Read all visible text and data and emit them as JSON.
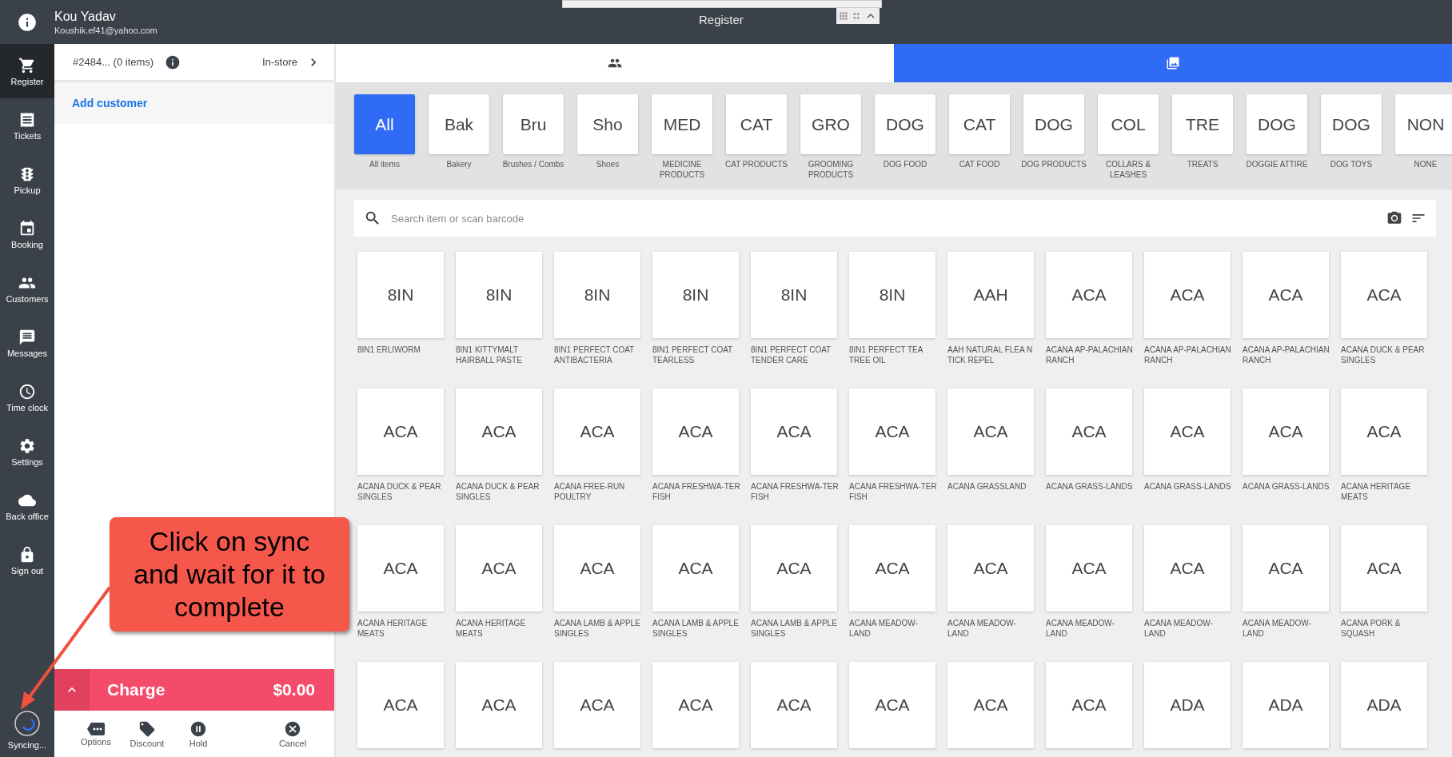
{
  "header": {
    "user_name": "Kou Yadav",
    "user_email": "Koushik.ef41@yahoo.com",
    "title": "Register"
  },
  "sidebar": {
    "items": [
      {
        "label": "Register",
        "selected": true
      },
      {
        "label": "Tickets",
        "selected": false
      },
      {
        "label": "Pickup",
        "selected": false
      },
      {
        "label": "Booking",
        "selected": false
      },
      {
        "label": "Customers",
        "selected": false
      },
      {
        "label": "Messages",
        "selected": false
      },
      {
        "label": "Time clock",
        "selected": false
      },
      {
        "label": "Settings",
        "selected": false
      },
      {
        "label": "Back office",
        "selected": false
      },
      {
        "label": "Sign out",
        "selected": false
      }
    ],
    "sync_label": "Syncing..."
  },
  "ticket": {
    "number": "#2484... (0 items)",
    "order_type": "In-store",
    "add_customer": "Add customer"
  },
  "charge": {
    "label": "Charge",
    "amount": "$0.00"
  },
  "actions": [
    {
      "label": "Options"
    },
    {
      "label": "Discount"
    },
    {
      "label": "Hold"
    },
    {
      "label": "Cancel"
    }
  ],
  "panel_tabs": [
    {
      "selected": false
    },
    {
      "selected": true
    }
  ],
  "categories": [
    {
      "abbr": "All",
      "label": "All items",
      "selected": true
    },
    {
      "abbr": "Bak",
      "label": "Bakery",
      "selected": false
    },
    {
      "abbr": "Bru",
      "label": "Brushes / Combs",
      "selected": false
    },
    {
      "abbr": "Sho",
      "label": "Shoes",
      "selected": false
    },
    {
      "abbr": "MED",
      "label": "MEDICINE PRODUCTS",
      "selected": false
    },
    {
      "abbr": "CAT",
      "label": "CAT PRODUCTS",
      "selected": false
    },
    {
      "abbr": "GRO",
      "label": "GROOMING PRODUCTS",
      "selected": false
    },
    {
      "abbr": "DOG",
      "label": "DOG FOOD",
      "selected": false
    },
    {
      "abbr": "CAT",
      "label": "CAT FOOD",
      "selected": false
    },
    {
      "abbr": "DOG",
      "label": "DOG PRODUCTS",
      "selected": false
    },
    {
      "abbr": "COL",
      "label": "COLLARS & LEASHES",
      "selected": false
    },
    {
      "abbr": "TRE",
      "label": "TREATS",
      "selected": false
    },
    {
      "abbr": "DOG",
      "label": "DOGGIE ATTIRE",
      "selected": false
    },
    {
      "abbr": "DOG",
      "label": "DOG TOYS",
      "selected": false
    },
    {
      "abbr": "NON",
      "label": "NONE",
      "selected": false
    }
  ],
  "search": {
    "placeholder": "Search item or scan barcode"
  },
  "products": [
    {
      "abbr": "8IN",
      "name": "8IN1 ERLIWORM"
    },
    {
      "abbr": "8IN",
      "name": "8IN1 KITTYMALT HAIRBALL PASTE"
    },
    {
      "abbr": "8IN",
      "name": "8IN1 PERFECT COAT ANTIBACTERIA"
    },
    {
      "abbr": "8IN",
      "name": "8IN1 PERFECT COAT TEARLESS"
    },
    {
      "abbr": "8IN",
      "name": "8IN1 PERFECT COAT TENDER CARE"
    },
    {
      "abbr": "8IN",
      "name": "8IN1 PERFECT TEA TREE OIL"
    },
    {
      "abbr": "AAH",
      "name": "AAH NATURAL FLEA N TICK REPEL"
    },
    {
      "abbr": "ACA",
      "name": "ACANA AP-PALACHIAN RANCH"
    },
    {
      "abbr": "ACA",
      "name": "ACANA AP-PALACHIAN RANCH"
    },
    {
      "abbr": "ACA",
      "name": "ACANA AP-PALACHIAN RANCH"
    },
    {
      "abbr": "ACA",
      "name": "ACANA DUCK & PEAR SINGLES"
    },
    {
      "abbr": "ACA",
      "name": "ACANA DUCK & PEAR SINGLES"
    },
    {
      "abbr": "ACA",
      "name": "ACANA DUCK & PEAR SINGLES"
    },
    {
      "abbr": "ACA",
      "name": "ACANA FREE-RUN POULTRY"
    },
    {
      "abbr": "ACA",
      "name": "ACANA FRESHWA-TER FISH"
    },
    {
      "abbr": "ACA",
      "name": "ACANA FRESHWA-TER FISH"
    },
    {
      "abbr": "ACA",
      "name": "ACANA FRESHWA-TER FISH"
    },
    {
      "abbr": "ACA",
      "name": "ACANA GRASSLAND"
    },
    {
      "abbr": "ACA",
      "name": "ACANA GRASS-LANDS"
    },
    {
      "abbr": "ACA",
      "name": "ACANA GRASS-LANDS"
    },
    {
      "abbr": "ACA",
      "name": "ACANA GRASS-LANDS"
    },
    {
      "abbr": "ACA",
      "name": "ACANA HERITAGE MEATS"
    },
    {
      "abbr": "ACA",
      "name": "ACANA HERITAGE MEATS"
    },
    {
      "abbr": "ACA",
      "name": "ACANA HERITAGE MEATS"
    },
    {
      "abbr": "ACA",
      "name": "ACANA LAMB & APPLE SINGLES"
    },
    {
      "abbr": "ACA",
      "name": "ACANA LAMB & APPLE SINGLES"
    },
    {
      "abbr": "ACA",
      "name": "ACANA LAMB & APPLE SINGLES"
    },
    {
      "abbr": "ACA",
      "name": "ACANA MEADOW-LAND"
    },
    {
      "abbr": "ACA",
      "name": "ACANA MEADOW-LAND"
    },
    {
      "abbr": "ACA",
      "name": "ACANA MEADOW-LAND"
    },
    {
      "abbr": "ACA",
      "name": "ACANA MEADOW-LAND"
    },
    {
      "abbr": "ACA",
      "name": "ACANA MEADOW-LAND"
    },
    {
      "abbr": "ACA",
      "name": "ACANA PORK & SQUASH"
    },
    {
      "abbr": "ACA"
    },
    {
      "abbr": "ACA"
    },
    {
      "abbr": "ACA"
    },
    {
      "abbr": "ACA"
    },
    {
      "abbr": "ACA"
    },
    {
      "abbr": "ACA"
    },
    {
      "abbr": "ACA"
    },
    {
      "abbr": "ACA"
    },
    {
      "abbr": "ADA"
    },
    {
      "abbr": "ADA"
    },
    {
      "abbr": "ADA"
    }
  ],
  "callout": {
    "text": "Click on sync and wait for it to complete"
  }
}
